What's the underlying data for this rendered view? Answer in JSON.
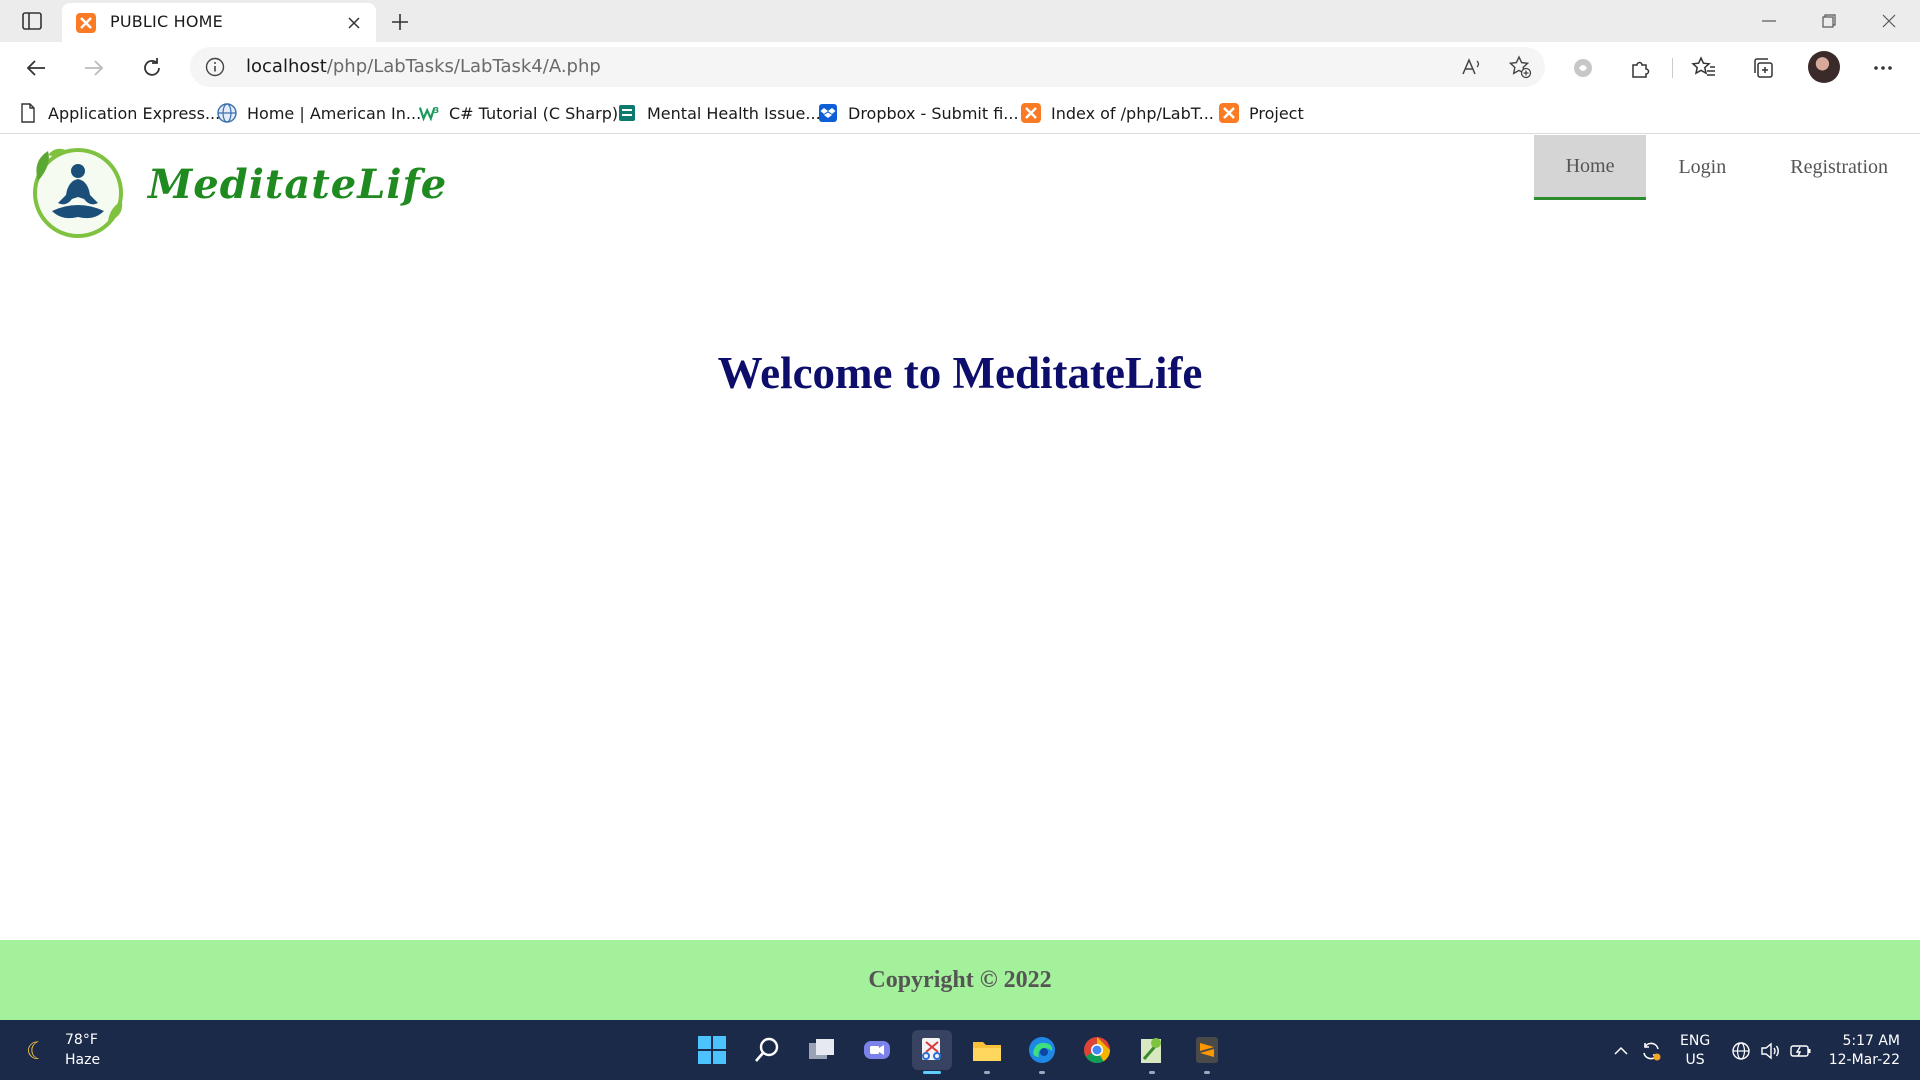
{
  "browser": {
    "tab": {
      "title": "PUBLIC HOME"
    },
    "address": {
      "host": "localhost",
      "path": "/php/LabTasks/LabTask4/A.php"
    },
    "bookmarks": [
      {
        "label": "Application Express..."
      },
      {
        "label": "Home | American In..."
      },
      {
        "label": "C# Tutorial (C Sharp)"
      },
      {
        "label": "Mental Health Issue..."
      },
      {
        "label": "Dropbox - Submit fi..."
      },
      {
        "label": "Index of /php/LabT..."
      },
      {
        "label": "Project"
      }
    ]
  },
  "site": {
    "brand": "MeditateLife",
    "nav": [
      {
        "label": "Home",
        "active": true
      },
      {
        "label": "Login",
        "active": false
      },
      {
        "label": "Registration",
        "active": false
      }
    ],
    "welcome": "Welcome to MeditateLife",
    "footer": "Copyright © 2022"
  },
  "taskbar": {
    "weather": {
      "temp": "78°F",
      "condition": "Haze"
    },
    "lang": {
      "line1": "ENG",
      "line2": "US"
    },
    "clock": {
      "time": "5:17 AM",
      "date": "12-Mar-22"
    }
  },
  "colors": {
    "welcome": "#0d0d6b",
    "brand": "#1f8a1f",
    "footer_bg": "#a4f19b",
    "nav_active_bg": "#d5d5d5",
    "nav_active_border": "#2e8b2e",
    "taskbar_bg": "#1c2a4a"
  }
}
